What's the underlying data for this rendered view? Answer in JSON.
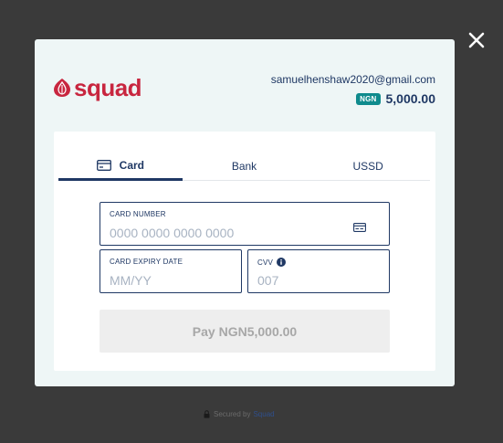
{
  "close": {
    "icon": "close-icon"
  },
  "merchant": {
    "logo_text": "squad",
    "logo_icon": "squad-logo-icon",
    "email": "samuelhenshaw2020@gmail.com",
    "currency": "NGN",
    "amount": "5,000.00"
  },
  "tabs": [
    {
      "label": "Card",
      "icon": "card-icon",
      "active": true
    },
    {
      "label": "Bank",
      "active": false
    },
    {
      "label": "USSD",
      "active": false
    }
  ],
  "form": {
    "card_number": {
      "label": "CARD NUMBER",
      "placeholder": "0000 0000 0000 0000",
      "icon": "credit-card-icon"
    },
    "expiry": {
      "label": "CARD EXPIRY DATE",
      "placeholder": "MM/YY"
    },
    "cvv": {
      "label": "CVV",
      "placeholder": "007",
      "icon": "info-icon"
    }
  },
  "pay_button": {
    "label": "Pay NGN5,000.00"
  },
  "footer": {
    "text": "Secured by",
    "brand": "Squad",
    "icon": "lock-icon"
  },
  "colors": {
    "brand": "#c8263f",
    "primary": "#1f3864",
    "badge": "#0f8b8d",
    "overlay": "#3a3a3a"
  }
}
